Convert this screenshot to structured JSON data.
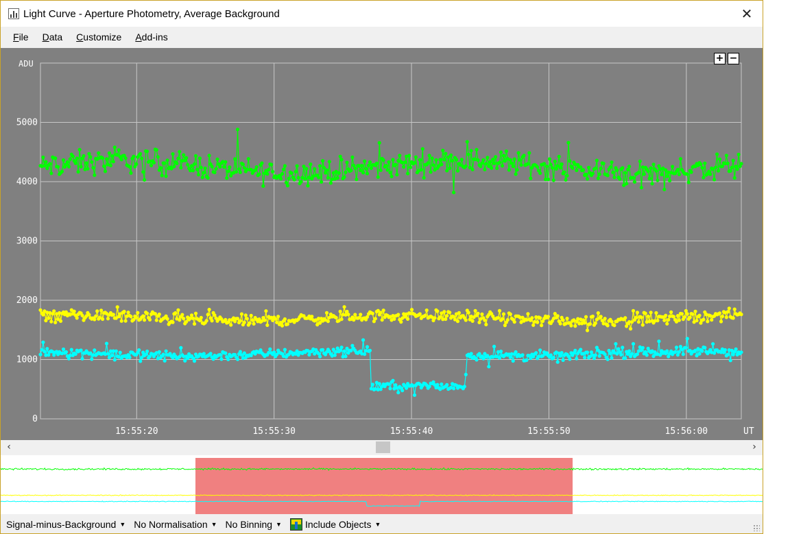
{
  "window": {
    "title": "Light Curve - Aperture Photometry, Average Background",
    "close_glyph": "✕"
  },
  "menu": [
    "File",
    "Data",
    "Customize",
    "Add-ins"
  ],
  "zoom": {
    "in_label": "+",
    "out_label": "−"
  },
  "scrollbar": {
    "left_glyph": "‹",
    "right_glyph": "›"
  },
  "status": {
    "signal": "Signal-minus-Background",
    "normalisation": "No Normalisation",
    "binning": "No Binning",
    "include_objects": "Include Objects"
  },
  "chart_data": {
    "type": "scatter",
    "ylabel": "ADU",
    "xlabel": "UT",
    "grid": true,
    "x_range_seconds": [
      "15:55:13",
      "15:56:04"
    ],
    "ylim": [
      0,
      6000
    ],
    "yticks": [
      0,
      1000,
      2000,
      3000,
      4000,
      5000
    ],
    "xticks": [
      "15:55:20",
      "15:55:30",
      "15:55:40",
      "15:55:50",
      "15:56:00"
    ],
    "series": [
      {
        "color": "#00ff00",
        "approx_level": 4250,
        "scatter": 250
      },
      {
        "color": "#ffff00",
        "approx_level": 1700,
        "scatter": 120
      },
      {
        "color": "#00ffff",
        "approx_level": 1100,
        "dip_level": 550,
        "dip_range": [
          "15:55:37",
          "15:55:44"
        ],
        "scatter": 100
      }
    ],
    "overview_selection": [
      "15:55:13",
      "15:56:04"
    ]
  }
}
